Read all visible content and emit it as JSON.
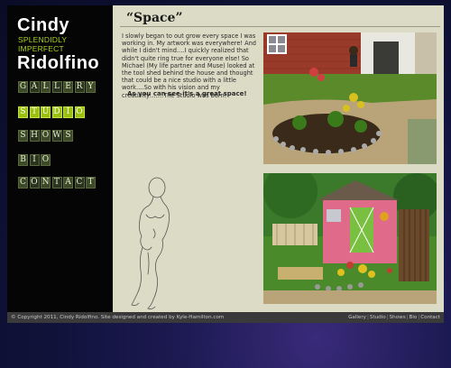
{
  "logo": {
    "line1": "Cindy",
    "line2": "SPLENDIDLY IMPERFECT",
    "line3": "Ridolfino"
  },
  "nav": [
    {
      "label": "GALLERY",
      "letters": [
        "G",
        "A",
        "L",
        "L",
        "E",
        "R",
        "Y"
      ]
    },
    {
      "label": "STUDIO",
      "letters": [
        "S",
        "T",
        "U",
        "D",
        "I",
        "O"
      ]
    },
    {
      "label": "SHOWS",
      "letters": [
        "S",
        "H",
        "O",
        "W",
        "S"
      ]
    },
    {
      "label": "BIO",
      "letters": [
        "B",
        "I",
        "O"
      ]
    },
    {
      "label": "CONTACT",
      "letters": [
        "C",
        "O",
        "N",
        "T",
        "A",
        "C",
        "T"
      ]
    }
  ],
  "page": {
    "title": "“Space”",
    "body": "I slowly began to out grow every space I was working in. My artwork was everywhere! And while I didn't mind….I quickly realized that didn't quite ring true for everyone else! So Michael (My life partner and Muse) looked at the tool shed behind the house and thought that could be a nice studio with a little work….So with his vision and my creativity…….The Studio was born!",
    "tagline": "As you can see it's a great space!"
  },
  "footer": {
    "copyright": "© Copyright 2011, Cindy Ridolfino. Site designed and created by Kyle-Hamilton.com",
    "links": [
      "Gallery",
      "Studio",
      "Shows",
      "Bio",
      "Contact"
    ],
    "separator": "|"
  },
  "colors": {
    "accent": "#9ac010",
    "content_bg": "#dcdcc6",
    "sidebar_bg": "#050505"
  }
}
